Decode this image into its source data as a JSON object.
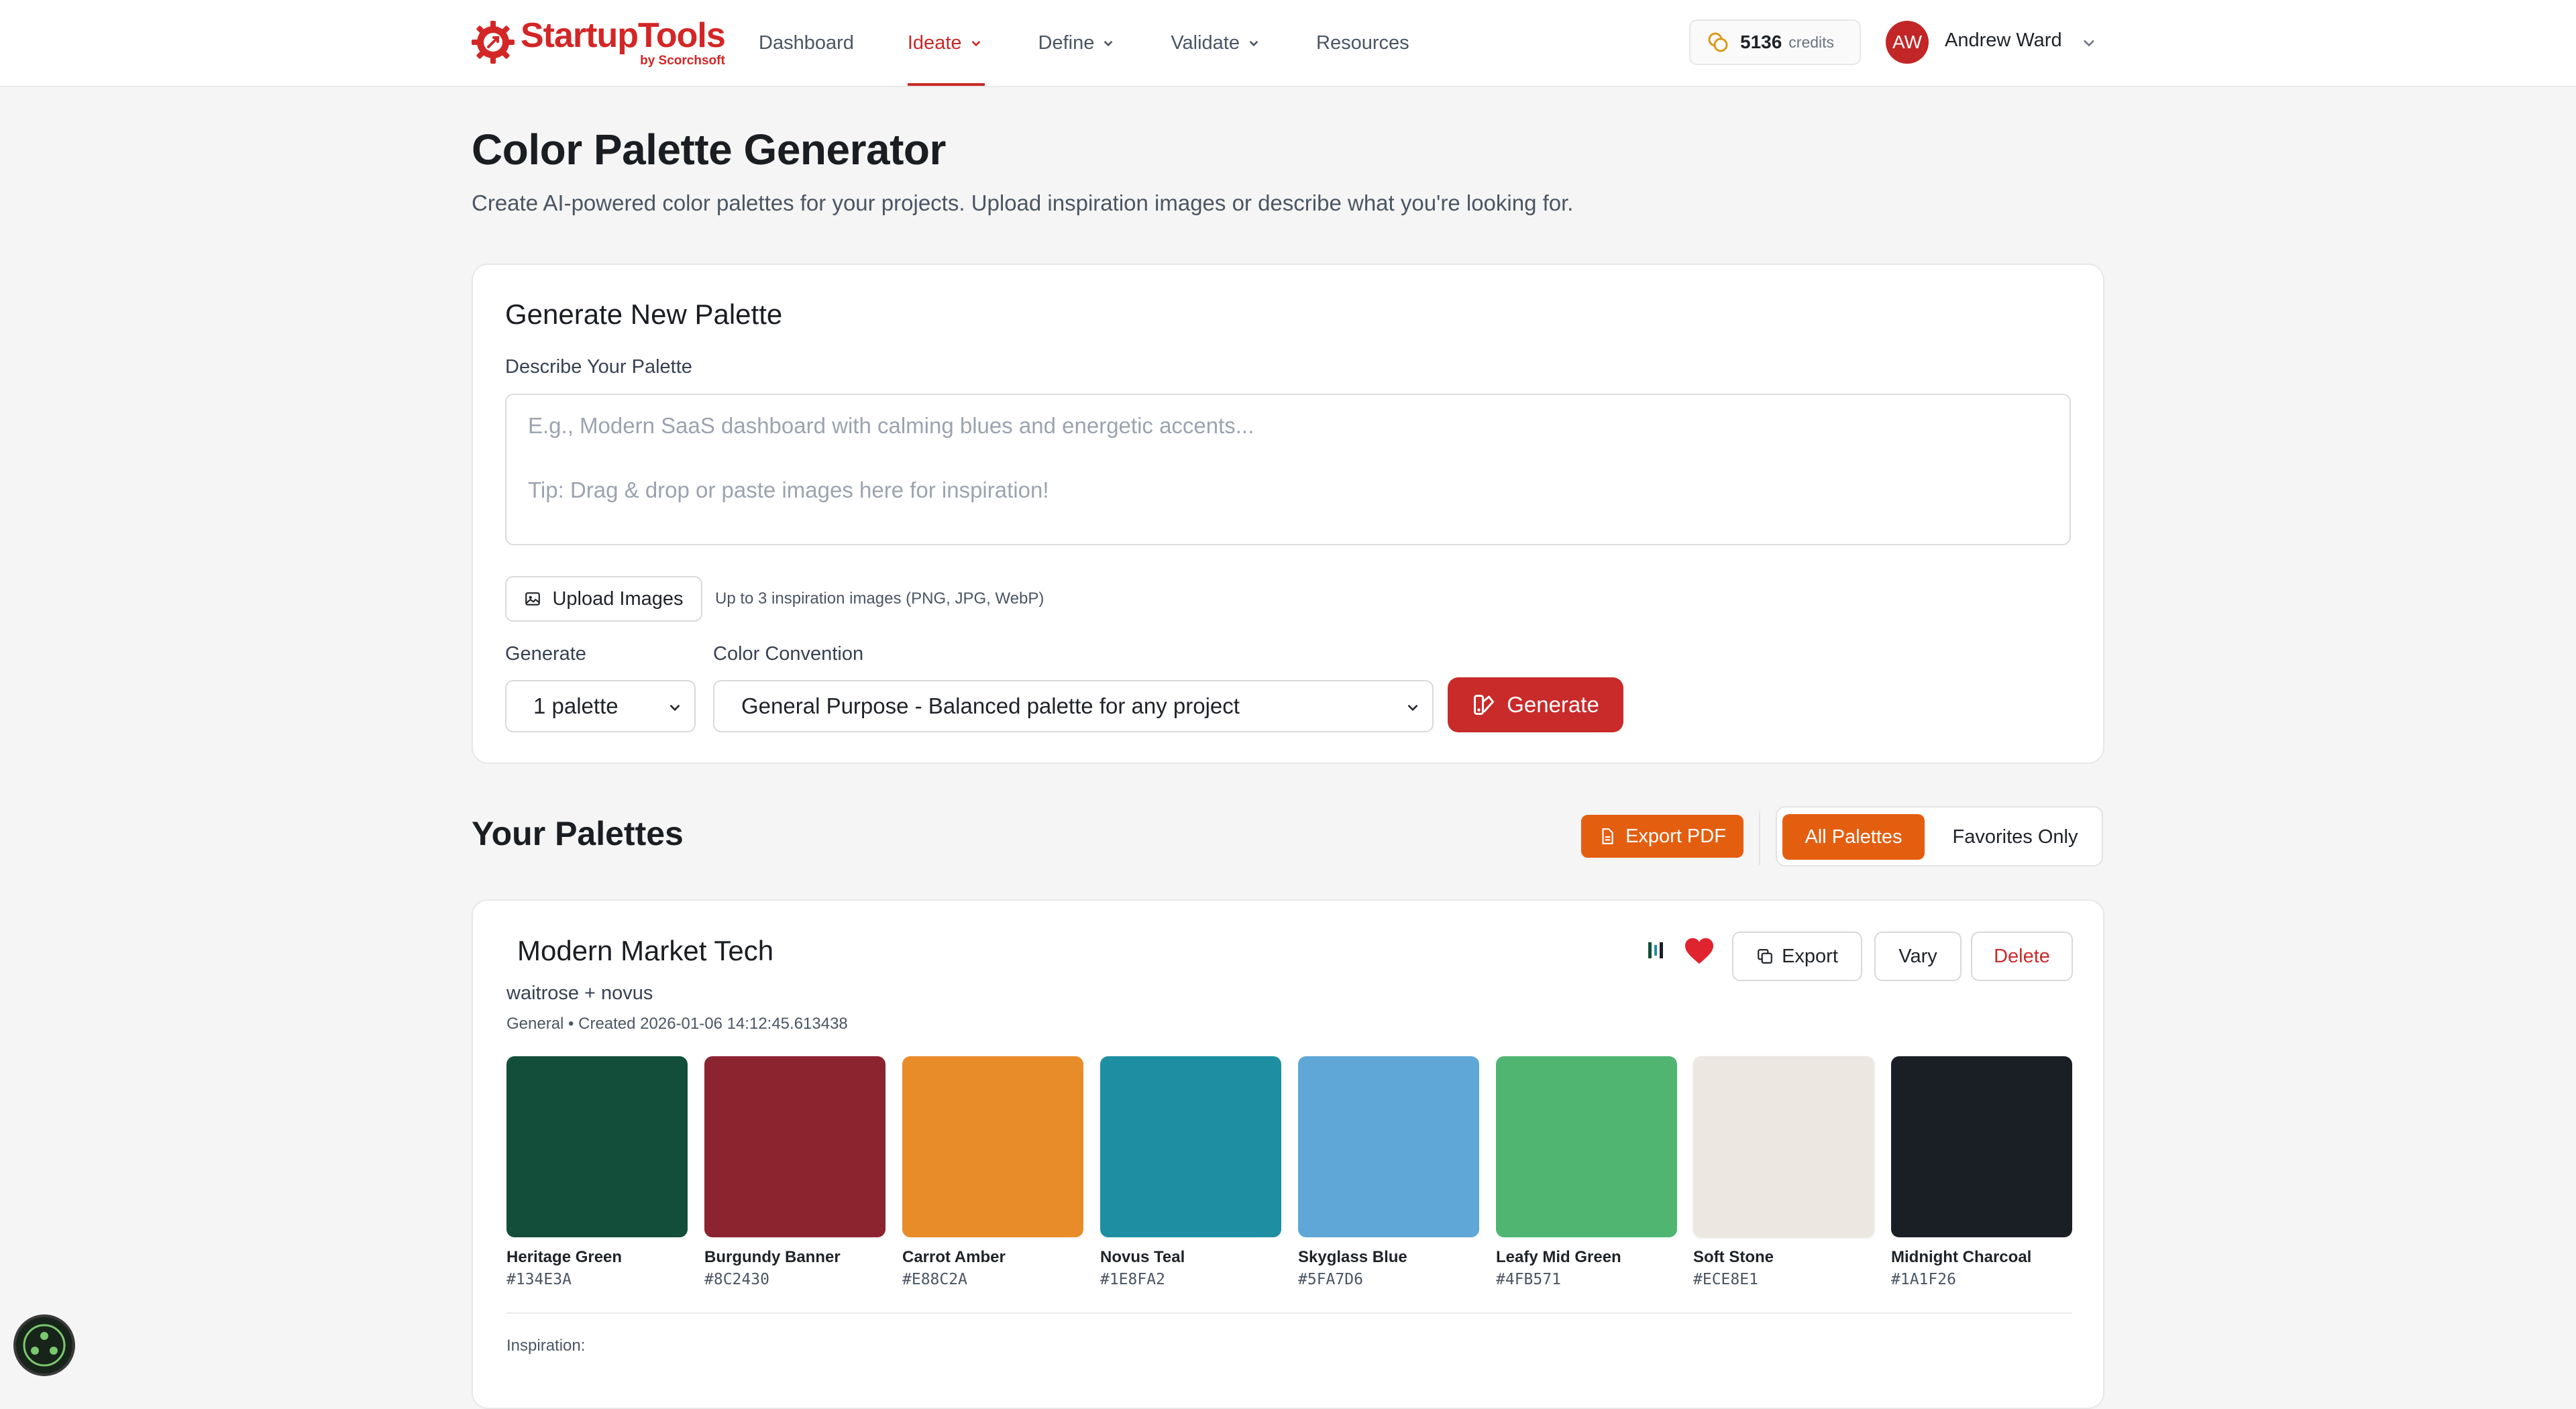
{
  "brand": {
    "name": "StartupTools",
    "sub": "by Scorchsoft",
    "color": "#d32626"
  },
  "nav": [
    {
      "label": "Dashboard",
      "has_menu": false,
      "active": false
    },
    {
      "label": "Ideate",
      "has_menu": true,
      "active": true
    },
    {
      "label": "Define",
      "has_menu": true,
      "active": false
    },
    {
      "label": "Validate",
      "has_menu": true,
      "active": false
    },
    {
      "label": "Resources",
      "has_menu": false,
      "active": false
    }
  ],
  "credits": {
    "amount": "5136",
    "label": "credits",
    "icon": "coins-icon"
  },
  "user": {
    "initials": "AW",
    "name": "Andrew Ward"
  },
  "page": {
    "title": "Color Palette Generator",
    "subtitle": "Create AI-powered color palettes for your projects. Upload inspiration images or describe what you're looking for."
  },
  "generator": {
    "title": "Generate New Palette",
    "describe_label": "Describe Your Palette",
    "describe_placeholder": "E.g., Modern SaaS dashboard with calming blues and energetic accents...",
    "describe_tip": "Tip: Drag & drop or paste images here for inspiration!",
    "upload_label": "Upload Images",
    "upload_hint": "Up to 3 inspiration images (PNG, JPG, WebP)",
    "count_label": "Generate",
    "count_value": "1 palette",
    "convention_label": "Color Convention",
    "convention_value": "General Purpose - Balanced palette for any project",
    "generate_label": "Generate",
    "accent": "#c92a2a"
  },
  "palettes_section": {
    "title": "Your Palettes",
    "export_pdf": "Export PDF",
    "filter_all": "All Palettes",
    "filter_favorites": "Favorites Only",
    "accent": "#e45e10"
  },
  "palette": {
    "name": "Modern Market Tech",
    "description": "waitrose + novus",
    "meta": "General • Created 2026-01-06 14:12:45.613438",
    "favorite": true,
    "export_label": "Export",
    "vary_label": "Vary",
    "delete_label": "Delete",
    "inspiration_label": "Inspiration:",
    "swatches": [
      {
        "name": "Heritage Green",
        "hex": "#134E3A"
      },
      {
        "name": "Burgundy Banner",
        "hex": "#8C2430"
      },
      {
        "name": "Carrot Amber",
        "hex": "#E88C2A"
      },
      {
        "name": "Novus Teal",
        "hex": "#1E8FA2"
      },
      {
        "name": "Skyglass Blue",
        "hex": "#5FA7D6"
      },
      {
        "name": "Leafy Mid Green",
        "hex": "#4FB571"
      },
      {
        "name": "Soft Stone",
        "hex": "#ECE8E1"
      },
      {
        "name": "Midnight Charcoal",
        "hex": "#1A1F26"
      }
    ]
  }
}
